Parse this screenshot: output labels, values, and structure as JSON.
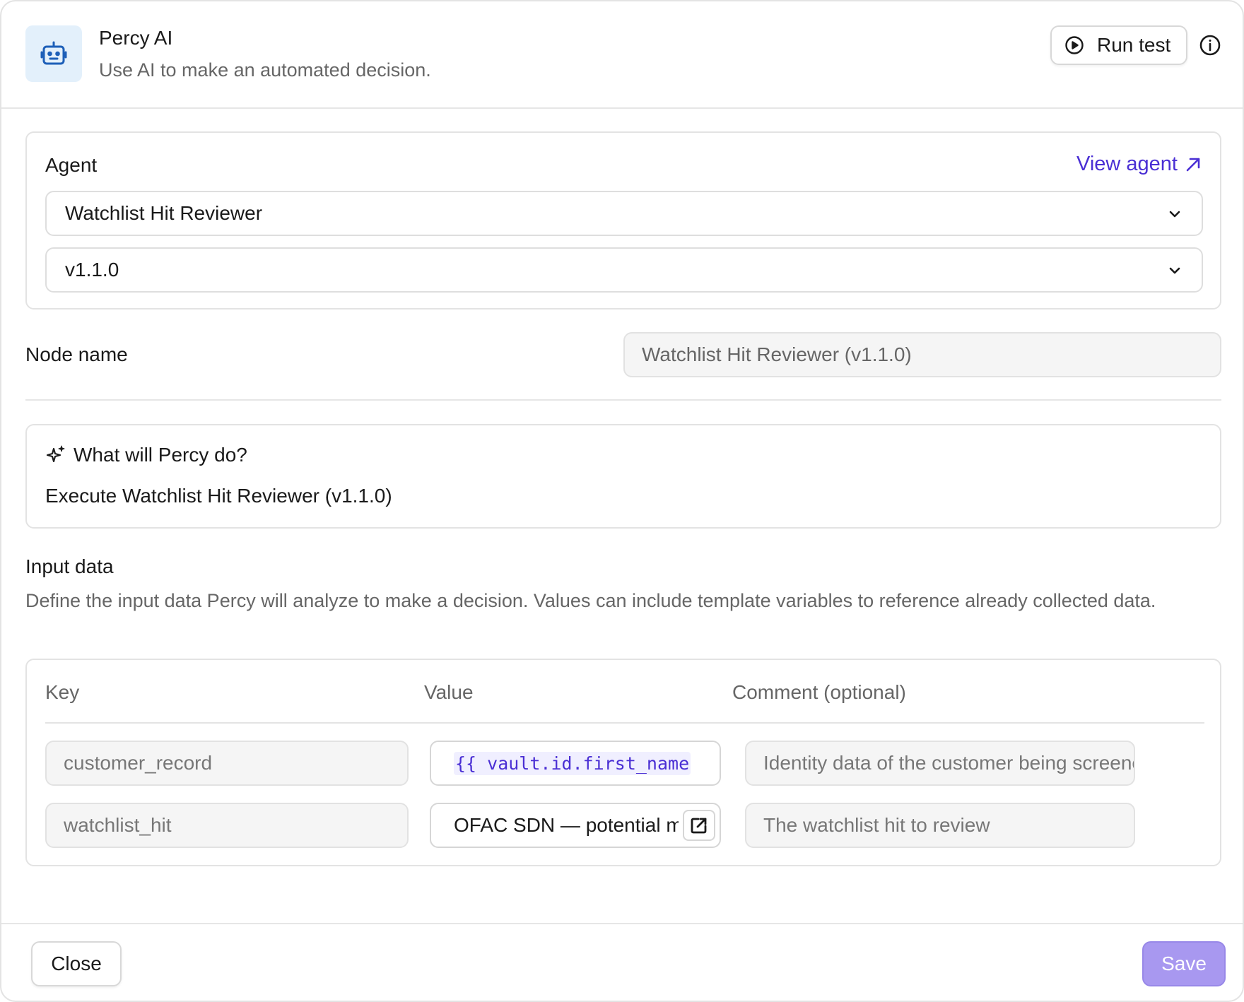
{
  "header": {
    "title": "Percy AI",
    "subtitle": "Use AI to make an automated decision.",
    "run_test_label": "Run test",
    "icon": "robot-icon",
    "icon_bg_color": "#e3f0fb",
    "icon_color": "#1d5fb8"
  },
  "agent": {
    "label": "Agent",
    "view_agent_label": "View agent",
    "selected_agent": "Watchlist Hit Reviewer",
    "selected_version": "v1.1.0"
  },
  "node": {
    "label": "Node name",
    "placeholder": "Watchlist Hit Reviewer (v1.1.0)"
  },
  "percy": {
    "heading": "What will Percy do?",
    "description": "Execute Watchlist Hit Reviewer (v1.1.0)"
  },
  "input_data": {
    "title": "Input data",
    "description": "Define the input data Percy will analyze to make a decision. Values can include template variables to reference already collected data.",
    "columns": {
      "key": "Key",
      "value": "Value",
      "comment": "Comment (optional)"
    },
    "rows": [
      {
        "key": "customer_record",
        "value": "{{ vault.id.first_name",
        "comment": "Identity data of the customer being screened"
      },
      {
        "key": "watchlist_hit",
        "value": "OFAC SDN — potential match",
        "comment": "The watchlist hit to review"
      }
    ]
  },
  "footer": {
    "close_label": "Close",
    "save_label": "Save"
  },
  "colors": {
    "accent": "#4a2fd4",
    "save_disabled": "#a898f0"
  }
}
